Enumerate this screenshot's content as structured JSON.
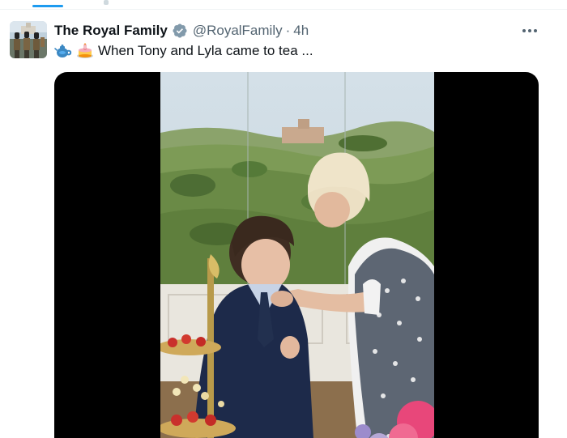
{
  "tweet": {
    "author": {
      "display_name": "The Royal Family",
      "handle": "@RoyalFamily",
      "verified_icon": "verified-badge-icon",
      "avatar_icon": "avatar-guardsmen"
    },
    "separator": "·",
    "time": "4h",
    "text": {
      "emojis": [
        "teapot-emoji-icon",
        "cake-emoji-icon"
      ],
      "body": "When Tony and Lyla came to tea ..."
    },
    "more_icon": "more-options-icon",
    "media": {
      "type": "video",
      "icon": "video-still"
    }
  },
  "colors": {
    "verified_badge": "#829aab",
    "secondary_text": "#536471",
    "primary_text": "#0f1419",
    "accent": "#1d9bf0"
  }
}
